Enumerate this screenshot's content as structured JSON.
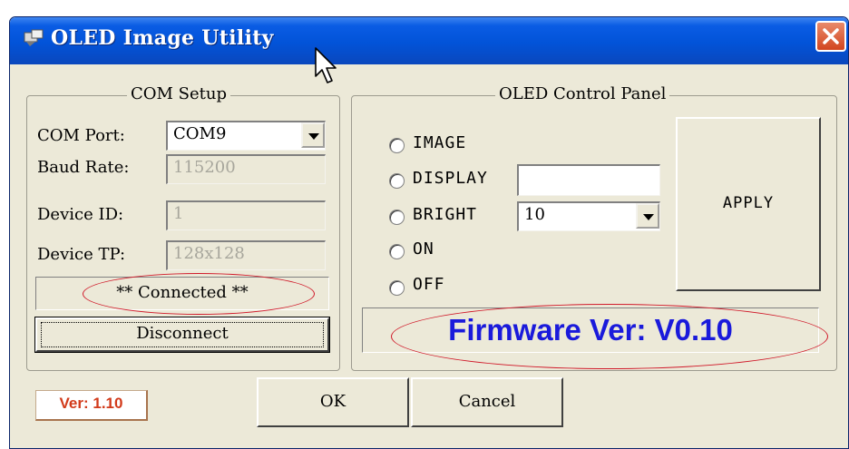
{
  "window": {
    "title": "OLED Image Utility"
  },
  "com_setup": {
    "title": "COM Setup",
    "com_port_label": "COM Port:",
    "com_port_value": "COM9",
    "baud_rate_label": "Baud Rate:",
    "baud_rate_value": "115200",
    "device_id_label": "Device ID:",
    "device_id_value": "1",
    "device_tp_label": "Device TP:",
    "device_tp_value": "128x128",
    "status": "** Connected **",
    "disconnect_label": "Disconnect"
  },
  "control_panel": {
    "title": "OLED Control Panel",
    "options": [
      "IMAGE",
      "DISPLAY",
      "BRIGHT",
      "ON",
      "OFF"
    ],
    "display_value": "",
    "bright_value": "10",
    "apply_label": "APPLY",
    "firmware": "Firmware Ver: V0.10"
  },
  "footer": {
    "version": "Ver: 1.10",
    "ok_label": "OK",
    "cancel_label": "Cancel"
  },
  "colors": {
    "titlebar": "#0253d8",
    "firmware_text": "#1a1adb",
    "annotation_ellipse": "#d01a2a",
    "version_text": "#d23a1a"
  }
}
